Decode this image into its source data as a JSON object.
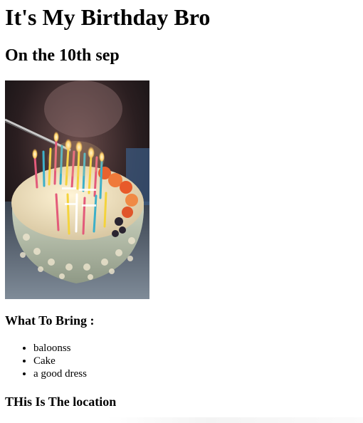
{
  "title": "It's My Birthday Bro",
  "date_line": "On the 10th sep",
  "photo": {
    "alt": "birthday cake with lit candles"
  },
  "bring": {
    "heading": "What To Bring :",
    "items": [
      "baloonss",
      "Cake",
      "a good dress"
    ]
  },
  "location": {
    "heading": "THis Is The location"
  }
}
